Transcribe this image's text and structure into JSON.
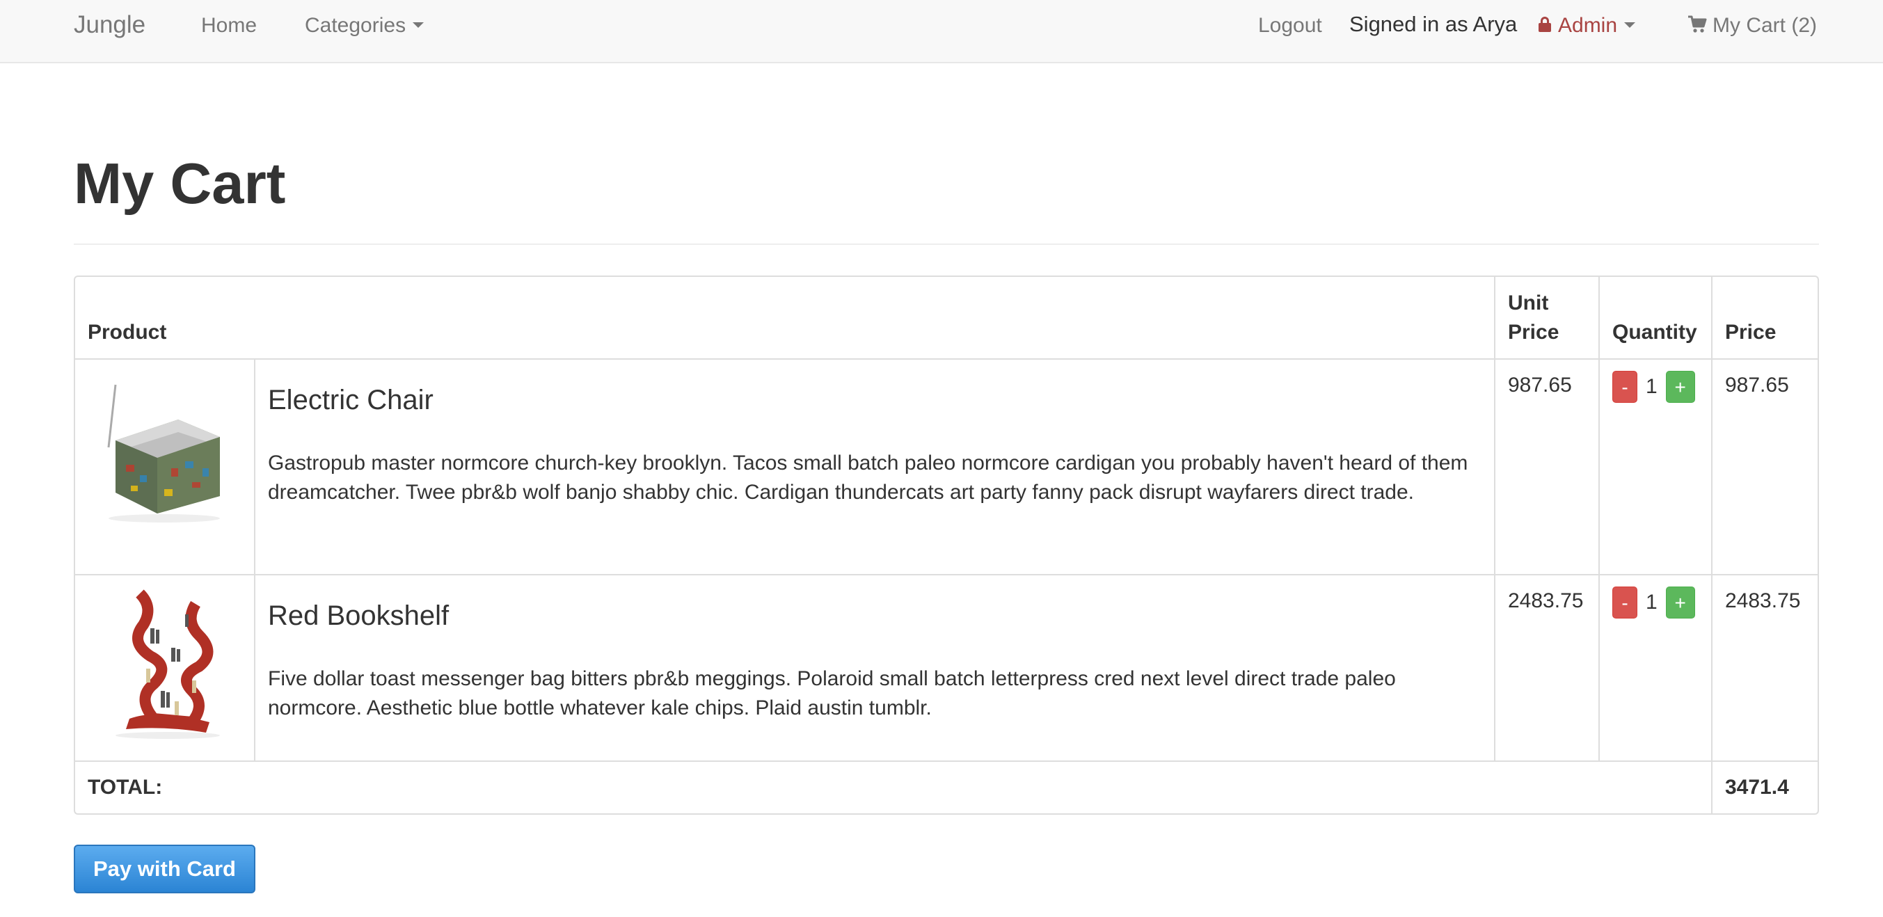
{
  "navbar": {
    "brand": "Jungle",
    "home": "Home",
    "categories": "Categories",
    "logout": "Logout",
    "signed_in": "Signed in as Arya",
    "admin": "Admin",
    "cart": "My Cart (2)"
  },
  "page": {
    "title": "My Cart"
  },
  "table": {
    "headers": {
      "product": "Product",
      "unit_price": "Unit Price",
      "quantity": "Quantity",
      "price": "Price"
    },
    "rows": [
      {
        "name": "Electric Chair",
        "description": "Gastropub master normcore church-key brooklyn. Tacos small batch paleo normcore cardigan you probably haven't heard of them dreamcatcher. Twee pbr&b wolf banjo shabby chic. Cardigan thundercats art party fanny pack disrupt wayfarers direct trade.",
        "unit_price": "987.65",
        "quantity": "1",
        "price": "987.65",
        "minus": "-",
        "plus": "+"
      },
      {
        "name": "Red Bookshelf",
        "description": "Five dollar toast messenger bag bitters pbr&b meggings. Polaroid small batch letterpress cred next level direct trade paleo normcore. Aesthetic blue bottle whatever kale chips. Plaid austin tumblr.",
        "unit_price": "2483.75",
        "quantity": "1",
        "price": "2483.75",
        "minus": "-",
        "plus": "+"
      }
    ],
    "total_label": "TOTAL:",
    "total_value": "3471.4"
  },
  "pay_button": "Pay with Card",
  "colors": {
    "danger": "#d9534f",
    "success": "#5cb85c",
    "admin": "#a94442",
    "primary": "#2b84d4"
  },
  "icons": {
    "admin": "lock-icon",
    "cart": "shopping-cart-icon",
    "dropdown": "caret-down-icon"
  }
}
